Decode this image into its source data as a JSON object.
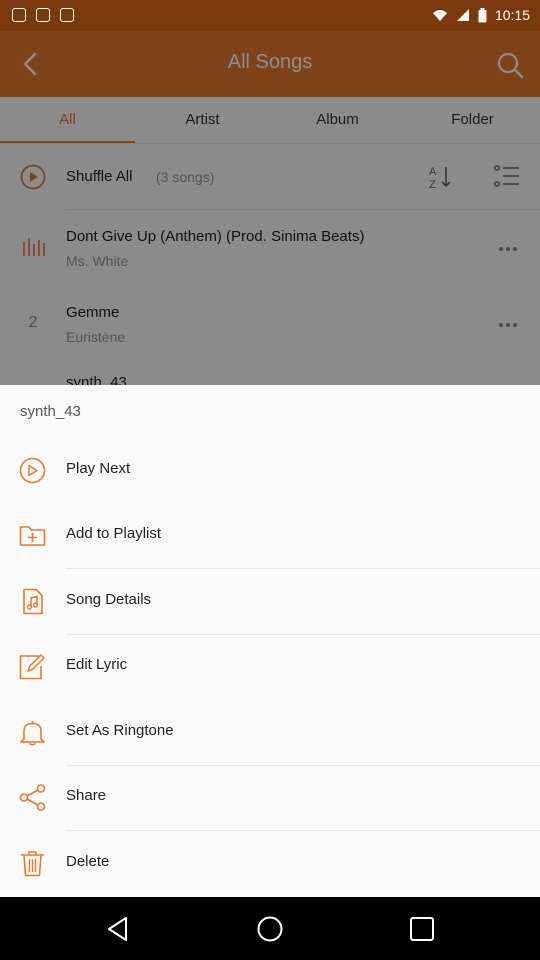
{
  "status_bar": {
    "time": "10:15"
  },
  "app_bar": {
    "title": "All Songs"
  },
  "tabs": [
    {
      "label": "All"
    },
    {
      "label": "Artist"
    },
    {
      "label": "Album"
    },
    {
      "label": "Folder"
    }
  ],
  "list": {
    "shuffle_label": "Shuffle All",
    "shuffle_count": "(3 songs)",
    "songs": [
      {
        "title": "Dont Give Up (Anthem) (Prod. Sinima Beats)",
        "artist": "Ms. White"
      },
      {
        "index": "2",
        "title": "Gemme",
        "artist": "Euristène"
      }
    ]
  },
  "sheet": {
    "title": "synth_43",
    "items": [
      {
        "label": "Play Next",
        "icon": "play-next-icon"
      },
      {
        "label": "Add to Playlist",
        "icon": "add-playlist-icon"
      },
      {
        "label": "Song Details",
        "icon": "song-details-icon"
      },
      {
        "label": "Edit Lyric",
        "icon": "edit-lyric-icon"
      },
      {
        "label": "Set As Ringtone",
        "icon": "bell-icon"
      },
      {
        "label": "Share",
        "icon": "share-icon"
      },
      {
        "label": "Delete",
        "icon": "trash-icon"
      }
    ]
  },
  "colors": {
    "accent": "#e67a2e",
    "status_bar": "#7a3a0e"
  }
}
